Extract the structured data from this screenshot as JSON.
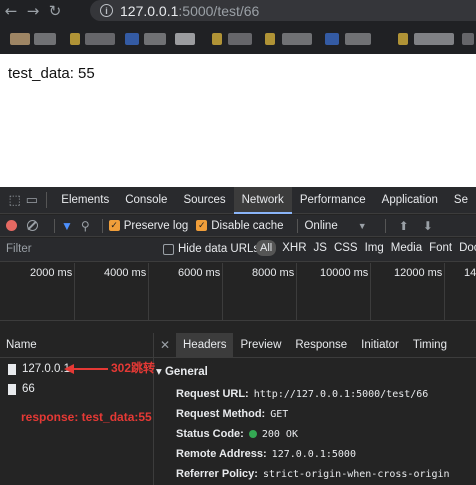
{
  "browser": {
    "url_host": "127.0.0.1",
    "url_rest": ":5000/test/66",
    "back_icon": "back-arrow-icon",
    "forward_icon": "forward-arrow-icon",
    "reload_icon": "reload-icon"
  },
  "page": {
    "text": "test_data: 55"
  },
  "devtools": {
    "tabs": [
      "Elements",
      "Console",
      "Sources",
      "Network",
      "Performance",
      "Application",
      "Se"
    ],
    "active_tab": "Network",
    "toolbar": {
      "preserve_log": "Preserve log",
      "disable_cache": "Disable cache",
      "throttle": "Online"
    },
    "filter": {
      "placeholder": "Filter",
      "hide_data_urls": "Hide data URLs",
      "types": [
        "All",
        "XHR",
        "JS",
        "CSS",
        "Img",
        "Media",
        "Font",
        "Doc"
      ]
    },
    "timeline_ticks": [
      "2000 ms",
      "4000 ms",
      "6000 ms",
      "8000 ms",
      "10000 ms",
      "12000 ms",
      "14"
    ],
    "name_header": "Name",
    "requests": [
      "127.0.0.1",
      "66"
    ],
    "detail_tabs": [
      "Headers",
      "Preview",
      "Response",
      "Initiator",
      "Timing"
    ],
    "active_detail_tab": "Headers",
    "general": {
      "title": "General",
      "request_url_key": "Request URL:",
      "request_url": "http://127.0.0.1:5000/test/66",
      "method_key": "Request Method:",
      "method": "GET",
      "status_key": "Status Code:",
      "status": "200 OK",
      "remote_key": "Remote Address:",
      "remote": "127.0.0.1:5000",
      "referrer_key": "Referrer Policy:",
      "referrer": "strict-origin-when-cross-origin"
    }
  },
  "annotations": {
    "redirect": "302跳转",
    "response": "response: test_data:55"
  },
  "colors": {
    "annotation": "#e53935",
    "devtools_bg": "#242424",
    "accent": "#8ab4f8"
  }
}
